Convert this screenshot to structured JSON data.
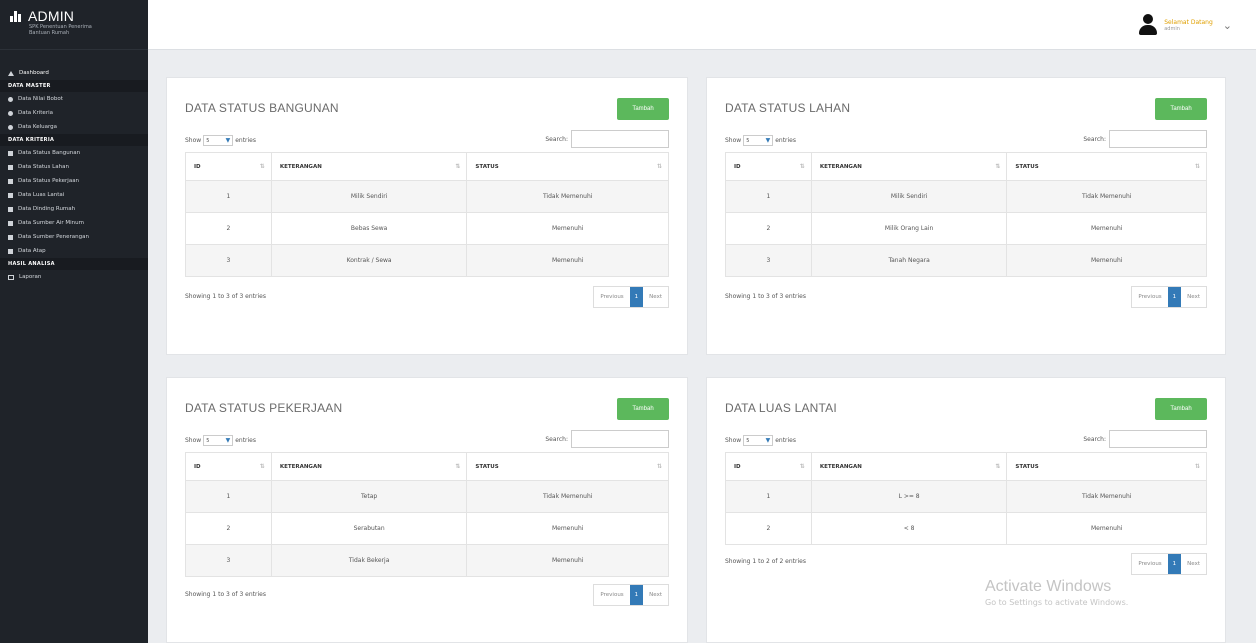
{
  "brand": {
    "title": "ADMIN",
    "subtitle_line1": "SPK Penentuan Penerima",
    "subtitle_line2": "Bantuan Rumah"
  },
  "sidebar": {
    "dashboard": "Dashboard",
    "header_master": "DATA MASTER",
    "master_items": [
      "Data Nilai Bobot",
      "Data Kriteria",
      "Data Keluarga"
    ],
    "header_kriteria": "DATA KRITERIA",
    "kriteria_items": [
      "Data Status Bangunan",
      "Data Status Lahan",
      "Data Status Pekerjaan",
      "Data Luas Lantai",
      "Data Dinding Rumah",
      "Data Sumber Air Minum",
      "Data Sumber Penerangan",
      "Data Atap"
    ],
    "header_hasil": "HASIL ANALISA",
    "hasil_items": [
      "Laporan"
    ]
  },
  "user": {
    "name": "Selamat Datang",
    "role": "admin"
  },
  "common": {
    "add_button": "Tambah",
    "show": "Show",
    "entries": "entries",
    "length_value": "5",
    "search_label": "Search:",
    "col_id": "ID",
    "col_ket": "KETERANGAN",
    "col_status": "STATUS",
    "prev": "Previous",
    "next": "Next",
    "page": "1"
  },
  "panels": [
    {
      "title": "DATA STATUS BANGUNAN",
      "rows": [
        [
          "1",
          "Milik Sendiri",
          "Tidak Memenuhi"
        ],
        [
          "2",
          "Bebas Sewa",
          "Memenuhi"
        ],
        [
          "3",
          "Kontrak / Sewa",
          "Memenuhi"
        ]
      ],
      "info": "Showing 1 to 3 of 3 entries"
    },
    {
      "title": "DATA STATUS LAHAN",
      "rows": [
        [
          "1",
          "Milik Sendiri",
          "Tidak Memenuhi"
        ],
        [
          "2",
          "Milik Orang Lain",
          "Memenuhi"
        ],
        [
          "3",
          "Tanah Negara",
          "Memenuhi"
        ]
      ],
      "info": "Showing 1 to 3 of 3 entries"
    },
    {
      "title": "DATA STATUS PEKERJAAN",
      "rows": [
        [
          "1",
          "Tetap",
          "Tidak Memenuhi"
        ],
        [
          "2",
          "Serabutan",
          "Memenuhi"
        ],
        [
          "3",
          "Tidak Bekerja",
          "Memenuhi"
        ]
      ],
      "info": "Showing 1 to 3 of 3 entries"
    },
    {
      "title": "DATA LUAS LANTAI",
      "rows": [
        [
          "1",
          "L >= 8",
          "Tidak Memenuhi"
        ],
        [
          "2",
          "< 8",
          "Memenuhi"
        ]
      ],
      "info": "Showing 1 to 2 of 2 entries"
    }
  ],
  "watermark": {
    "line1": "Activate Windows",
    "line2": "Go to Settings to activate Windows."
  }
}
